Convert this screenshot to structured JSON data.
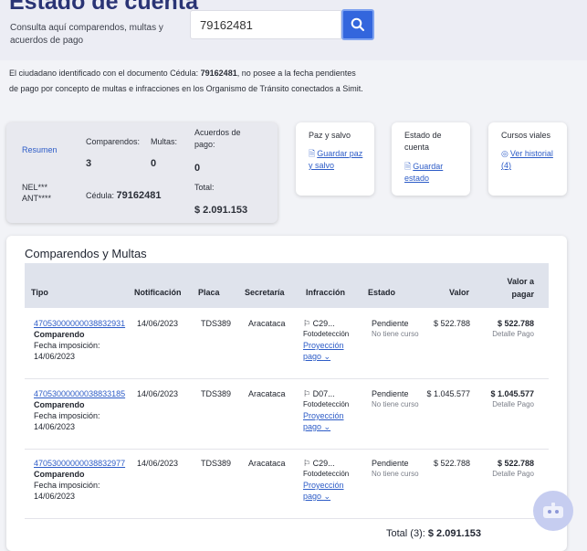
{
  "header": {
    "title": "Estado de cuenta",
    "subtitle": "Consulta aquí comparendos, multas y acuerdos de pago",
    "search_value": "79162481"
  },
  "info": {
    "prefix": "El ciudadano identificado con el documento Cédula: ",
    "document": "79162481",
    "suffix": ", no posee a la fecha pendientes de pago por concepto de multas e infracciones en los Organismo de Tránsito conectados a Simit."
  },
  "summary": {
    "resumen_label": "Resumen",
    "name_line1": "NEL***",
    "name_line2": "ANT****",
    "comparendos_label": "Comparendos:",
    "comparendos_value": "3",
    "multas_label": "Multas:",
    "multas_value": "0",
    "acuerdos_label": "Acuerdos de pago:",
    "acuerdos_value": "0",
    "cedula_label": "Cédula:",
    "cedula_value": "79162481",
    "total_label": "Total:",
    "total_value": "$ 2.091.153"
  },
  "cards": {
    "paz_title": "Paz y salvo",
    "paz_link": "Guardar paz y salvo",
    "estado_title": "Estado de cuenta",
    "estado_link": "Guardar estado",
    "cursos_title": "Cursos viales",
    "cursos_link": "Ver historial (4)"
  },
  "table": {
    "title": "Comparendos y Multas",
    "headers": {
      "tipo": "Tipo",
      "notificacion": "Notificación",
      "placa": "Placa",
      "secretaria": "Secretaría",
      "infraccion": "Infracción",
      "estado": "Estado",
      "valor": "Valor",
      "valor_pagar": "Valor a pagar"
    },
    "rows": [
      {
        "id": "47053000000038832931",
        "tipo": "Comparendo",
        "fecha_label": "Fecha imposición:",
        "fecha": "14/06/2023",
        "notificacion": "14/06/2023",
        "placa": "TDS389",
        "secretaria": "Aracataca",
        "infraccion": "C29...",
        "fuente": "Fotodetección",
        "proyeccion": "Proyección pago",
        "estado": "Pendiente",
        "curso": "No tiene curso",
        "valor": "$ 522.788",
        "valor_pagar": "$ 522.788",
        "detalle": "Detalle Pago"
      },
      {
        "id": "47053000000038833185",
        "tipo": "Comparendo",
        "fecha_label": "Fecha imposición:",
        "fecha": "14/06/2023",
        "notificacion": "14/06/2023",
        "placa": "TDS389",
        "secretaria": "Aracataca",
        "infraccion": "D07...",
        "fuente": "Fotodetección",
        "proyeccion": "Proyección pago",
        "estado": "Pendiente",
        "curso": "No tiene curso",
        "valor": "$ 1.045.577",
        "valor_pagar": "$ 1.045.577",
        "detalle": "Detalle Pago"
      },
      {
        "id": "47053000000038832977",
        "tipo": "Comparendo",
        "fecha_label": "Fecha imposición:",
        "fecha": "14/06/2023",
        "notificacion": "14/06/2023",
        "placa": "TDS389",
        "secretaria": "Aracataca",
        "infraccion": "C29...",
        "fuente": "Fotodetección",
        "proyeccion": "Proyección pago",
        "estado": "Pendiente",
        "curso": "No tiene curso",
        "valor": "$ 522.788",
        "valor_pagar": "$ 522.788",
        "detalle": "Detalle Pago"
      }
    ],
    "total_label": "Total (3):",
    "total_value": "$ 2.091.153"
  },
  "colors": {
    "accent": "#3366dd",
    "title": "#2a3475",
    "link": "#2d5cc7"
  }
}
